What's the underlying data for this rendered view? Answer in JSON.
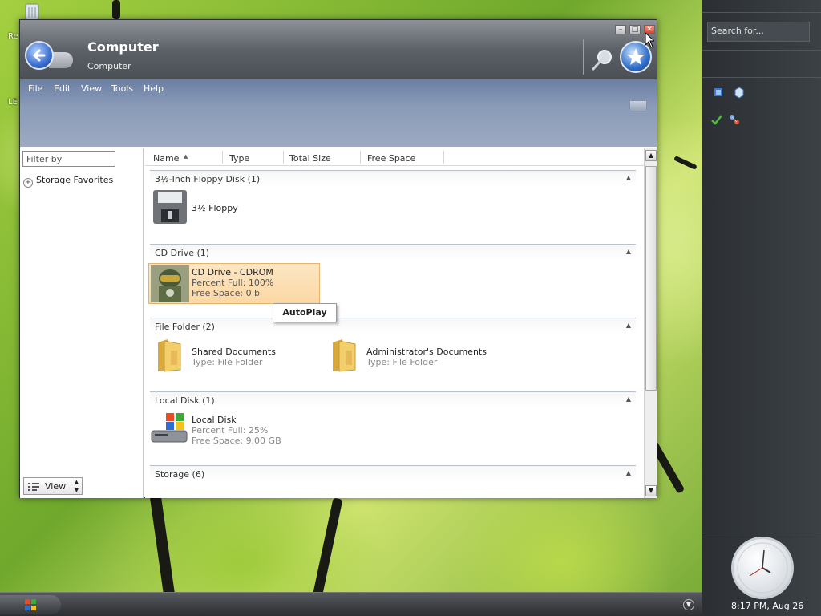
{
  "desktop": {
    "icons": [
      {
        "label": "Re"
      },
      {
        "label": "LE"
      }
    ]
  },
  "window": {
    "title": "Computer",
    "subtitle": "Computer",
    "controls": {
      "min": "–",
      "max": "□",
      "close": "✕"
    }
  },
  "menu": {
    "items": [
      "File",
      "Edit",
      "View",
      "Tools",
      "Help"
    ]
  },
  "left_pane": {
    "filter_placeholder": "Filter by",
    "favorites_label": "Storage Favorites",
    "view_button_label": "View"
  },
  "columns": [
    "Name",
    "Type",
    "Total Size",
    "Free Space"
  ],
  "groups": [
    {
      "label": "3½-Inch Floppy Disk (1)",
      "items": [
        {
          "name": "3½ Floppy"
        }
      ]
    },
    {
      "label": "CD Drive (1)",
      "items": [
        {
          "name": "CD Drive - CDROM",
          "line2": "Percent Full: 100%",
          "line3": "Free Space: 0 b"
        }
      ]
    },
    {
      "label": "File Folder (2)",
      "items": [
        {
          "name": "Shared Documents",
          "line2": "Type: File Folder"
        },
        {
          "name": "Administrator's Documents",
          "line2": "Type: File Folder"
        }
      ]
    },
    {
      "label": "Local Disk (1)",
      "items": [
        {
          "name": "Local Disk",
          "line2": "Percent Full: 25%",
          "line3": "Free Space: 9.00 GB"
        }
      ]
    },
    {
      "label": "Storage (6)",
      "items": []
    }
  ],
  "context_popup": {
    "label": "AutoPlay"
  },
  "sidebar": {
    "search_placeholder": "Search for...",
    "clock_time": "8:17 PM, Aug 26"
  },
  "colors": {
    "titlebar": "#5c6168",
    "menubar": "#8a9bb8",
    "selection": "#fbd8a4",
    "sidebar": "#33373b"
  }
}
